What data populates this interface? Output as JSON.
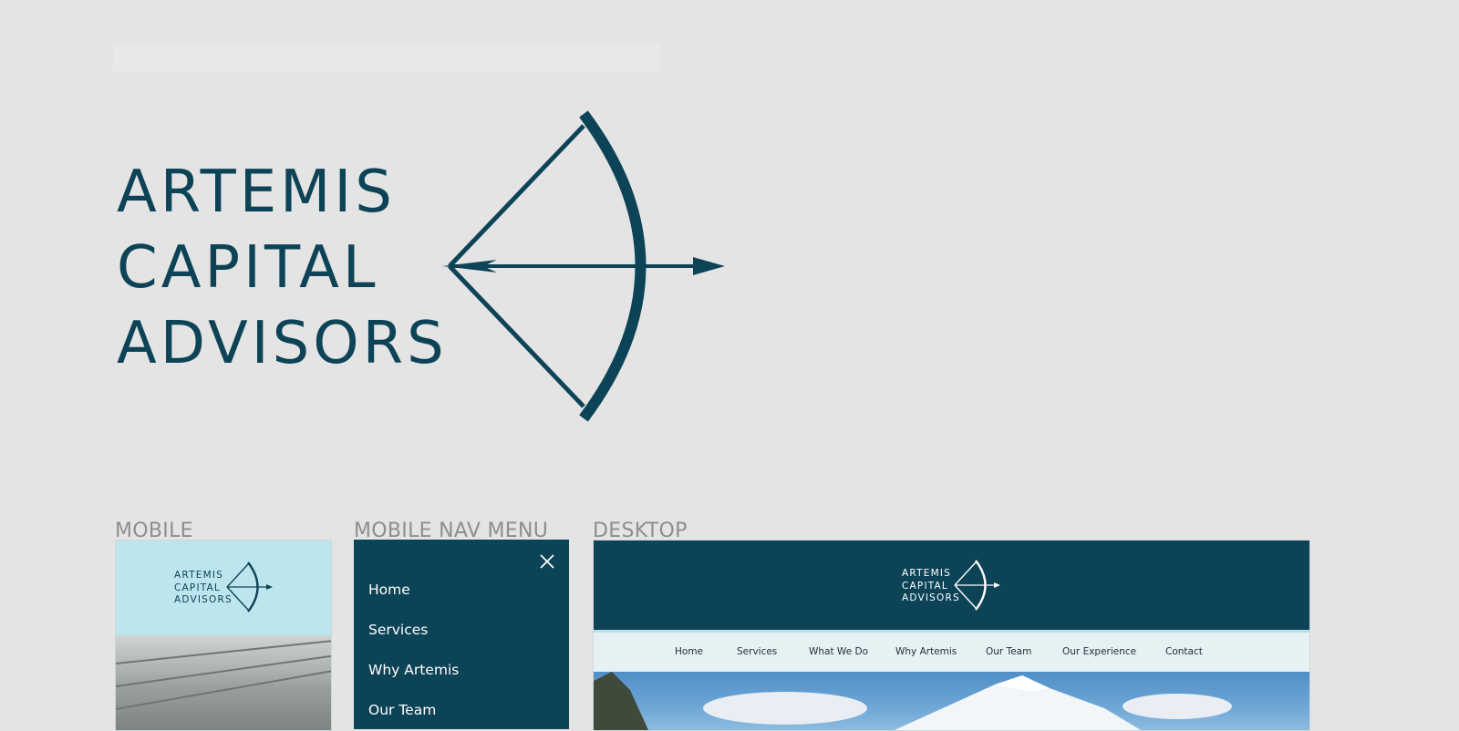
{
  "brand": {
    "line1": "ARTEMIS",
    "line2": "CAPITAL",
    "line3": "ADVISORS"
  },
  "colors": {
    "primary": "#0d4356",
    "light_blue": "#bde5ee",
    "nav_bg": "#e6f1f3",
    "background": "#e4e4e4",
    "label_gray": "#8e8e8e"
  },
  "sections": {
    "mobile": "MOBILE",
    "mobile_nav": "MOBILE NAV MENU",
    "desktop": "DESKTOP"
  },
  "mobile_nav": {
    "items": [
      "Home",
      "Services",
      "Why Artemis",
      "Our Team"
    ],
    "close_icon": "close-icon"
  },
  "desktop_nav": {
    "items": [
      "Home",
      "Services",
      "What We Do",
      "Why Artemis",
      "Our Team",
      "Our Experience",
      "Contact"
    ]
  }
}
